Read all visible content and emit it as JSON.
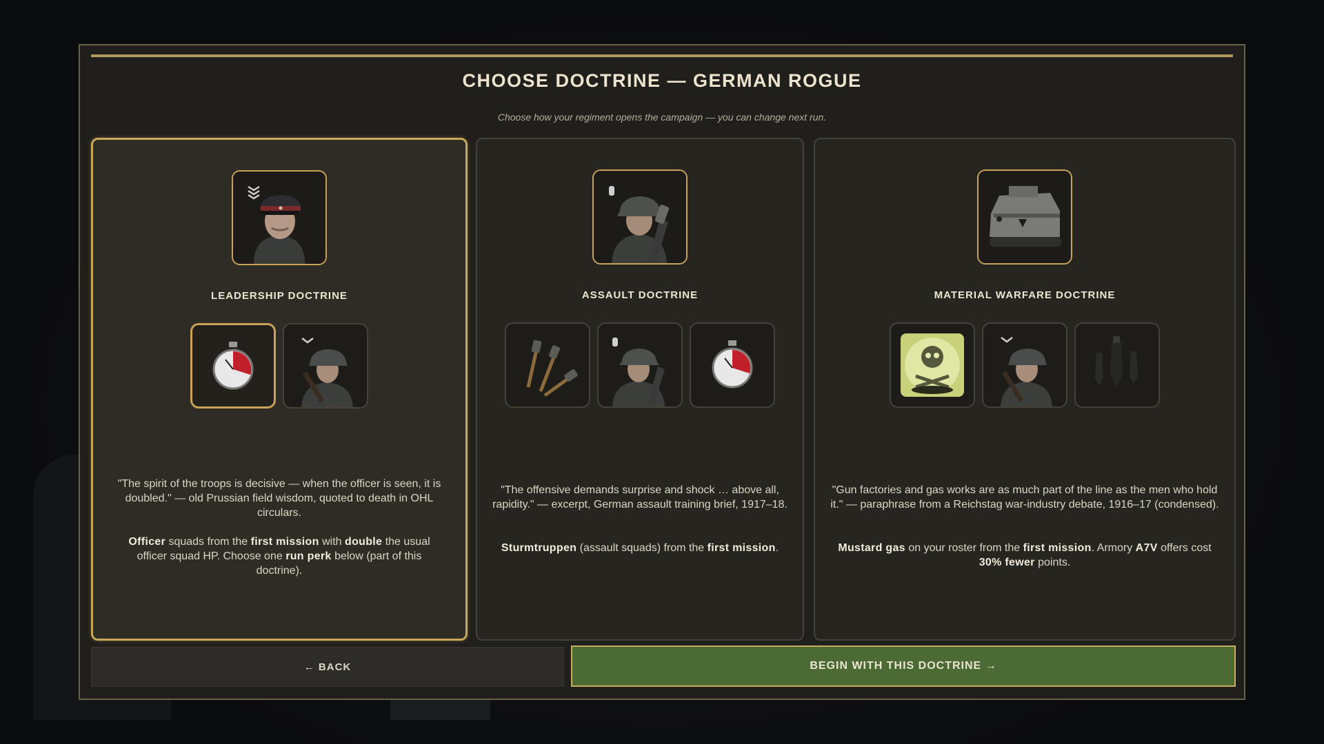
{
  "header": {
    "title": "CHOOSE DOCTRINE — GERMAN ROGUE",
    "subtitle": "Choose how your regiment opens the campaign — you can change next run."
  },
  "cards": [
    {
      "title": "LEADERSHIP DOCTRINE",
      "selected": true,
      "portrait_icon": "officer-portrait-icon",
      "units": [
        {
          "icon": "stopwatch-icon",
          "active": true
        },
        {
          "icon": "rifleman-icon",
          "active": false
        }
      ],
      "quote": "\"The spirit of the troops is decisive — when the officer is seen, it is doubled.\" — old Prussian field wisdom, quoted to death in OHL circulars.",
      "body": {
        "b1": "Officer",
        "t1": " squads from the ",
        "b2": "first mission",
        "t2": " with ",
        "b3": "double",
        "t3": " the usual officer squad HP. Choose one ",
        "b4": "run perk",
        "t4": " below (part of this doctrine)."
      }
    },
    {
      "title": "ASSAULT DOCTRINE",
      "selected": false,
      "portrait_icon": "stormtrooper-portrait-icon",
      "units": [
        {
          "icon": "stick-grenades-icon",
          "active": false
        },
        {
          "icon": "stormtrooper-icon",
          "active": false
        },
        {
          "icon": "stopwatch-icon",
          "active": false
        }
      ],
      "quote": "\"The offensive demands surprise and shock … above all, rapidity.\" — excerpt, German assault training brief, 1917–18.",
      "body": {
        "b1": "Sturmtruppen",
        "t1": " (assault squads) from the ",
        "b2": "first mission",
        "t2": "."
      }
    },
    {
      "title": "MATERIAL WARFARE DOCTRINE",
      "selected": false,
      "portrait_icon": "a7v-tank-portrait-icon",
      "units": [
        {
          "icon": "gas-skull-icon",
          "active": false
        },
        {
          "icon": "rifleman-icon",
          "active": false
        },
        {
          "icon": "mortar-shells-icon",
          "active": false
        }
      ],
      "quote": "\"Gun factories and gas works are as much part of the line as the men who hold it.\" — paraphrase from a Reichstag war-industry debate, 1916–17 (condensed).",
      "body": {
        "b1": "Mustard gas",
        "t1": " on your roster from the ",
        "b2": "first mission",
        "t2": ". Armory ",
        "b3": "A7V",
        "t3": " offers cost ",
        "b4": "30% fewer",
        "t4": " points."
      }
    }
  ],
  "buttons": {
    "back": "← BACK",
    "begin": "BEGIN WITH THIS DOCTRINE →"
  },
  "colors": {
    "accent_gold": "#c9a357",
    "begin_green": "#4c6a33",
    "panel_bg": "#211f1b"
  }
}
